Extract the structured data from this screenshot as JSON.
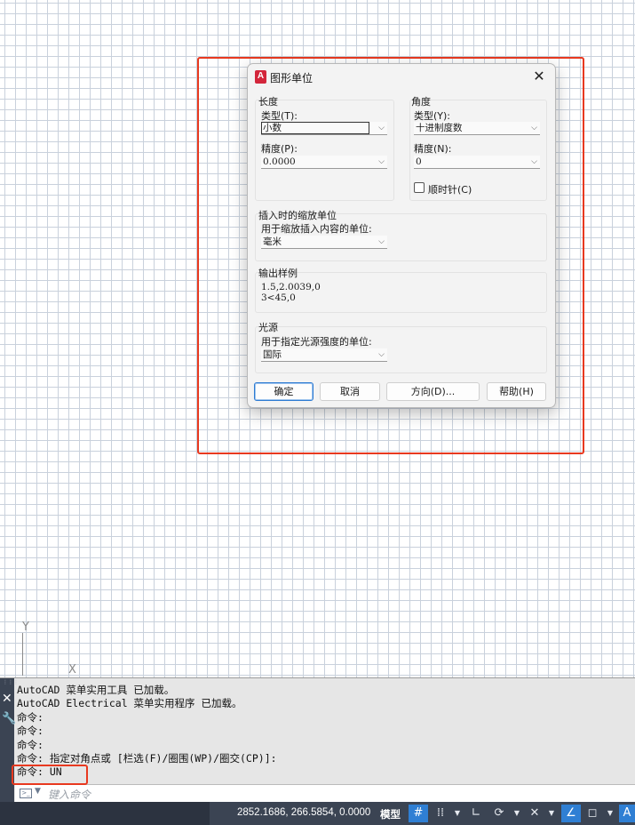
{
  "dialog": {
    "title": "图形单位",
    "app_icon_letter": "A",
    "close_glyph": "✕",
    "length": {
      "group_label": "长度",
      "type_label": "类型(T):",
      "type_value": "小数",
      "precision_label": "精度(P):",
      "precision_value": "0.0000"
    },
    "angle": {
      "group_label": "角度",
      "type_label": "类型(Y):",
      "type_value": "十进制度数",
      "precision_label": "精度(N):",
      "precision_value": "0",
      "clockwise_label": "顺时针(C)",
      "clockwise_checked": false
    },
    "insertion": {
      "group_label": "插入时的缩放单位",
      "field_label": "用于缩放插入内容的单位:",
      "value": "毫米"
    },
    "sample": {
      "group_label": "输出样例",
      "line1": "1.5,2.0039,0",
      "line2": "3<45,0"
    },
    "lighting": {
      "group_label": "光源",
      "field_label": "用于指定光源强度的单位:",
      "value": "国际"
    },
    "buttons": {
      "ok": "确定",
      "cancel": "取消",
      "direction": "方向(D)...",
      "help": "帮助(H)"
    }
  },
  "ucs": {
    "y_label": "Y",
    "x_label": "X"
  },
  "command_window": {
    "history": [
      "AutoCAD 菜单实用工具 已加载。",
      "AutoCAD Electrical 菜单实用程序 已加载。",
      "命令:",
      "命令:",
      "命令:",
      "命令: 指定对角点或 [栏选(F)/圈围(WP)/圈交(CP)]:",
      "命令: UN"
    ],
    "input_placeholder": "键入命令"
  },
  "statusbar": {
    "coordinates": "2852.1686, 266.5854, 0.0000",
    "model_label": "模型"
  },
  "colors": {
    "highlight": "#e8391f",
    "accent": "#2f7fd4",
    "statusbar_bg": "#3b4453"
  }
}
